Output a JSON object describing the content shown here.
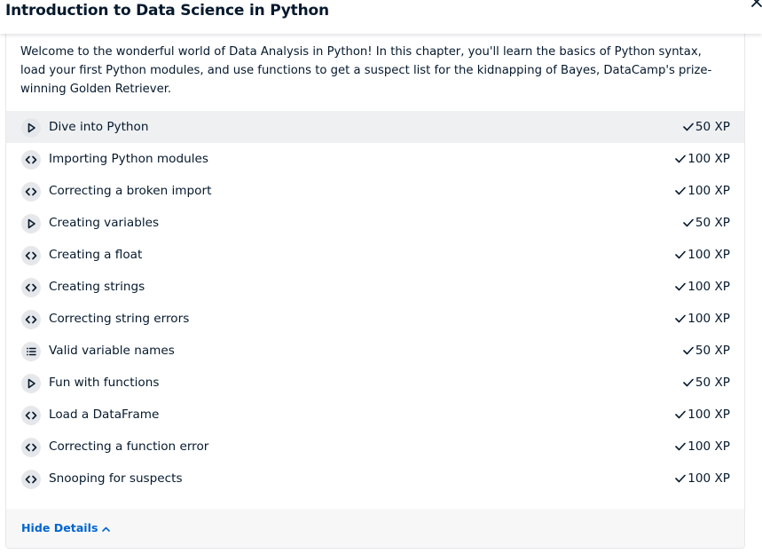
{
  "header": {
    "title": "Introduction to Data Science in Python"
  },
  "chapter": {
    "description": "Welcome to the wonderful world of Data Analysis in Python! In this chapter, you'll learn the basics of Python syntax, load your first Python modules, and use functions to get a suspect list for the kidnapping of Bayes, DataCamp's prize-winning Golden Retriever.",
    "exercises": [
      {
        "label": "Dive into Python",
        "xp": "50 XP",
        "icon": "play-icon"
      },
      {
        "label": "Importing Python modules",
        "xp": "100 XP",
        "icon": "code-icon"
      },
      {
        "label": "Correcting a broken import",
        "xp": "100 XP",
        "icon": "code-icon"
      },
      {
        "label": "Creating variables",
        "xp": "50 XP",
        "icon": "play-icon"
      },
      {
        "label": "Creating a float",
        "xp": "100 XP",
        "icon": "code-icon"
      },
      {
        "label": "Creating strings",
        "xp": "100 XP",
        "icon": "code-icon"
      },
      {
        "label": "Correcting string errors",
        "xp": "100 XP",
        "icon": "code-icon"
      },
      {
        "label": "Valid variable names",
        "xp": "50 XP",
        "icon": "list-icon"
      },
      {
        "label": "Fun with functions",
        "xp": "50 XP",
        "icon": "play-icon"
      },
      {
        "label": "Load a DataFrame",
        "xp": "100 XP",
        "icon": "code-icon"
      },
      {
        "label": "Correcting a function error",
        "xp": "100 XP",
        "icon": "code-icon"
      },
      {
        "label": "Snooping for suspects",
        "xp": "100 XP",
        "icon": "code-icon"
      }
    ],
    "toggle_label": "Hide Details"
  },
  "colors": {
    "text": "#05192d",
    "link": "#0065d1",
    "badge": "#e6e7ea",
    "highlight": "#eff0f2"
  }
}
